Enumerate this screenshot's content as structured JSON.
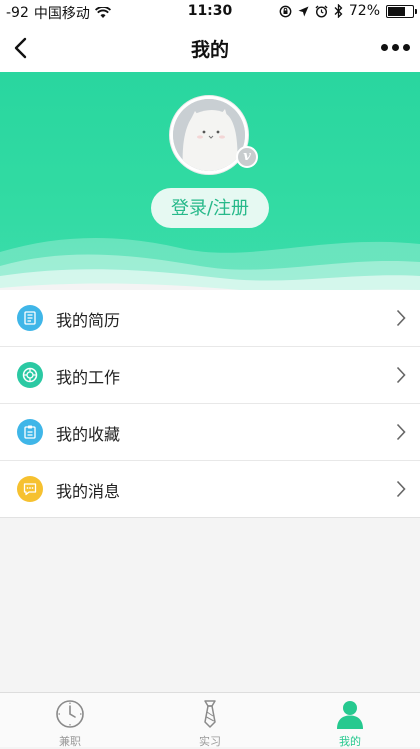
{
  "status_bar": {
    "signal": "-92",
    "carrier": "中国移动",
    "time": "11:30",
    "battery": "72%",
    "battery_level": 0.72
  },
  "nav": {
    "title": "我的"
  },
  "profile": {
    "login_label": "登录/注册",
    "badge_letter": "v"
  },
  "menu": {
    "items": [
      {
        "label": "我的简历",
        "icon": "resume-icon",
        "color": "#3fb6e8"
      },
      {
        "label": "我的工作",
        "icon": "lifebuoy-icon",
        "color": "#2bc9a3"
      },
      {
        "label": "我的收藏",
        "icon": "clipboard-icon",
        "color": "#3fb6e8"
      },
      {
        "label": "我的消息",
        "icon": "message-icon",
        "color": "#f6c130"
      }
    ]
  },
  "tabbar": {
    "items": [
      {
        "label": "兼职",
        "icon": "clock-icon",
        "active": false
      },
      {
        "label": "实习",
        "icon": "tie-icon",
        "active": false
      },
      {
        "label": "我的",
        "icon": "person-icon",
        "active": true
      }
    ]
  },
  "colors": {
    "brand_green": "#2fd8a0",
    "active_tab": "#26c98f"
  }
}
